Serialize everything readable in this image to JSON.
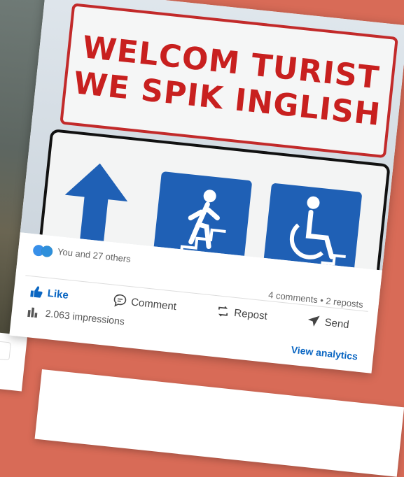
{
  "sign": {
    "line1": "WELCOM TURIST",
    "line2": "WE SPIK INGLISH"
  },
  "reactions": {
    "text": "You and 27 others",
    "counts": "4 comments • 2 reposts"
  },
  "actions": {
    "like": "Like",
    "comment": "Comment",
    "repost": "Repost",
    "send": "Send"
  },
  "stats": {
    "impressions": "2.063 impressions",
    "view_analytics": "View analytics"
  },
  "colors": {
    "background": "#d86b57",
    "accent": "#0a66c2",
    "sign_red": "#c8201f",
    "sign_blue": "#1f60b5"
  }
}
